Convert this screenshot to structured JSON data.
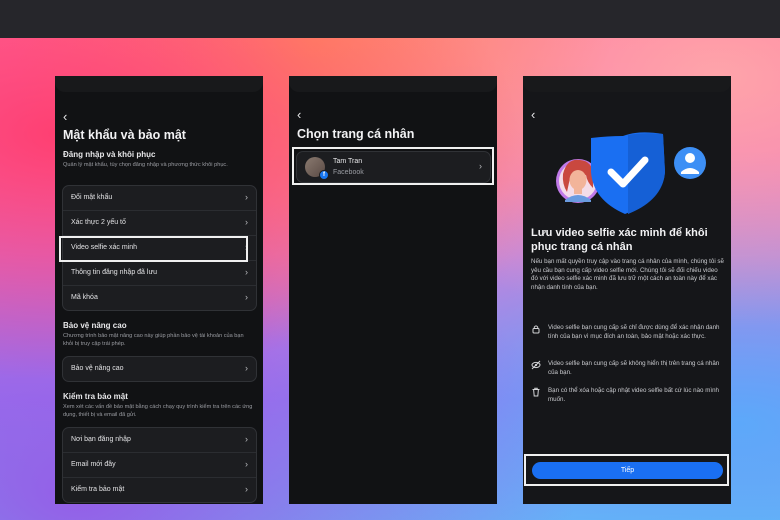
{
  "screen1": {
    "back": "‹",
    "title": "Mật khẩu và bảo mật",
    "section1": {
      "heading": "Đăng nhập và khôi phục",
      "desc": "Quản lý mật khẩu, tùy chọn đăng nhập và phương thức khôi phục.",
      "items": [
        {
          "label": "Đổi mật khẩu"
        },
        {
          "label": "Xác thực 2 yếu tố"
        },
        {
          "label": "Video selfie xác minh"
        },
        {
          "label": "Thông tin đăng nhập đã lưu"
        },
        {
          "label": "Mã khóa"
        }
      ]
    },
    "section2": {
      "heading": "Bảo vệ nâng cao",
      "desc": "Chương trình bảo mật nâng cao này giúp phần bảo vệ tài khoản của bạn khỏi bị truy cập trái phép.",
      "items": [
        {
          "label": "Bảo vệ nâng cao"
        }
      ]
    },
    "section3": {
      "heading": "Kiểm tra bảo mật",
      "desc": "Xem xét các vấn đề bảo mật bằng cách chạy quy trình kiểm tra trên các ứng dụng, thiết bị và email đã gửi.",
      "items": [
        {
          "label": "Nơi bạn đăng nhập"
        },
        {
          "label": "Email mới đây"
        },
        {
          "label": "Kiểm tra bảo mật"
        }
      ]
    },
    "chevron": "›"
  },
  "screen2": {
    "back": "‹",
    "title": "Chọn trang cá nhân",
    "profile": {
      "name": "Tam Tran",
      "platform": "Facebook"
    },
    "fb_badge": "f",
    "chevron": "›"
  },
  "screen3": {
    "back": "‹",
    "title": "Lưu video selfie xác minh để khôi phục trang cá nhân",
    "body": "Nếu bạn mất quyền truy cập vào trang cá nhân của mình, chúng tôi sẽ yêu cầu bạn cung cấp video selfie mới. Chúng tôi sẽ đối chiếu video đó với video selfie xác minh đã lưu trữ một cách an toàn này để xác nhận danh tính của bạn.",
    "bullets": [
      {
        "icon": "lock-icon",
        "text": "Video selfie bạn cung cấp sẽ chỉ được dùng để xác nhận danh tính của bạn vì mục đích an toàn, bảo mật hoặc xác thực."
      },
      {
        "icon": "eye-off-icon",
        "text": "Video selfie bạn cung cấp sẽ không hiển thị trên trang cá nhân của bạn."
      },
      {
        "icon": "trash-icon",
        "text": "Bạn có thể xóa hoặc cập nhật video selfie bất cứ lúc nào mình muốn."
      }
    ],
    "button": "Tiếp",
    "colors": {
      "shield": "#1a6ff2",
      "button": "#1a6ff2",
      "avatar_ring": "#c07ae8"
    }
  }
}
